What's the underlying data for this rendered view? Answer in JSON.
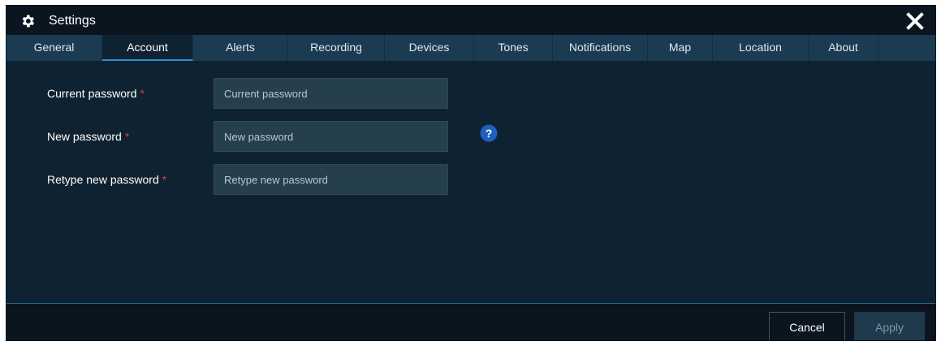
{
  "window": {
    "title": "Settings",
    "icon": "gear-icon",
    "close_icon": "close-icon"
  },
  "tabs": [
    {
      "label": "General",
      "active": false
    },
    {
      "label": "Account",
      "active": true
    },
    {
      "label": "Alerts",
      "active": false
    },
    {
      "label": "Recording",
      "active": false
    },
    {
      "label": "Devices",
      "active": false
    },
    {
      "label": "Tones",
      "active": false
    },
    {
      "label": "Notifications",
      "active": false
    },
    {
      "label": "Map",
      "active": false
    },
    {
      "label": "Location",
      "active": false
    },
    {
      "label": "About",
      "active": false
    }
  ],
  "form": {
    "required_marker": "*",
    "current_password": {
      "label": "Current password",
      "placeholder": "Current password",
      "value": ""
    },
    "new_password": {
      "label": "New password",
      "placeholder": "New password",
      "value": ""
    },
    "retype_password": {
      "label": "Retype new password",
      "placeholder": "Retype new password",
      "value": ""
    },
    "help_icon": "question-circle-icon"
  },
  "footer": {
    "cancel_label": "Cancel",
    "apply_label": "Apply"
  },
  "colors": {
    "background": "#0f2231",
    "tab_bar": "#1b3b52",
    "active_tab_underline": "#2e8fd6",
    "required": "#e2413f",
    "help_icon": "#1e5fbf"
  }
}
